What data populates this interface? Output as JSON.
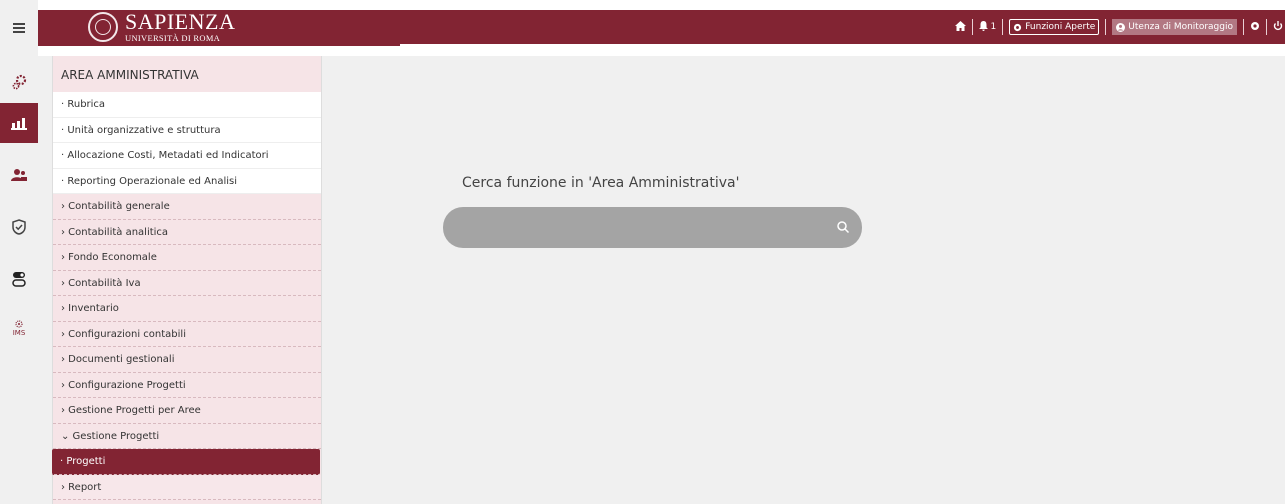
{
  "app": {
    "logo_main": "SAPIENZA",
    "logo_sub": "UNIVERSITÀ DI ROMA"
  },
  "topnav": {
    "notifications_count": "1",
    "open_functions_label": "Funzioni Aperte",
    "user_label": "Utenza di Monitoraggio"
  },
  "sidebar": {
    "icons": [
      "gears-icon",
      "chart-icon",
      "users-icon",
      "shield-check-icon",
      "toggle-icon",
      "ims-icon"
    ]
  },
  "panel": {
    "title": "AREA AMMINISTRATIVA",
    "items": [
      "· Rubrica",
      "· Unità organizzative e struttura",
      "· Allocazione Costi, Metadati ed Indicatori",
      "· Reporting Operazionale ed Analisi",
      "› Contabilità generale",
      "› Contabilità analitica",
      "› Fondo Economale",
      "› Contabilità Iva",
      "› Inventario",
      "› Configurazioni contabili",
      "› Documenti gestionali",
      "› Configurazione Progetti",
      "› Gestione Progetti per Aree",
      "⌄ Gestione Progetti",
      "· Progetti",
      "› Report"
    ]
  },
  "main": {
    "search_label": "Cerca funzione in 'Area Amministrativa'",
    "search_value": ""
  },
  "colors": {
    "brand": "#822433",
    "panel_bg": "#f6e4e7"
  }
}
